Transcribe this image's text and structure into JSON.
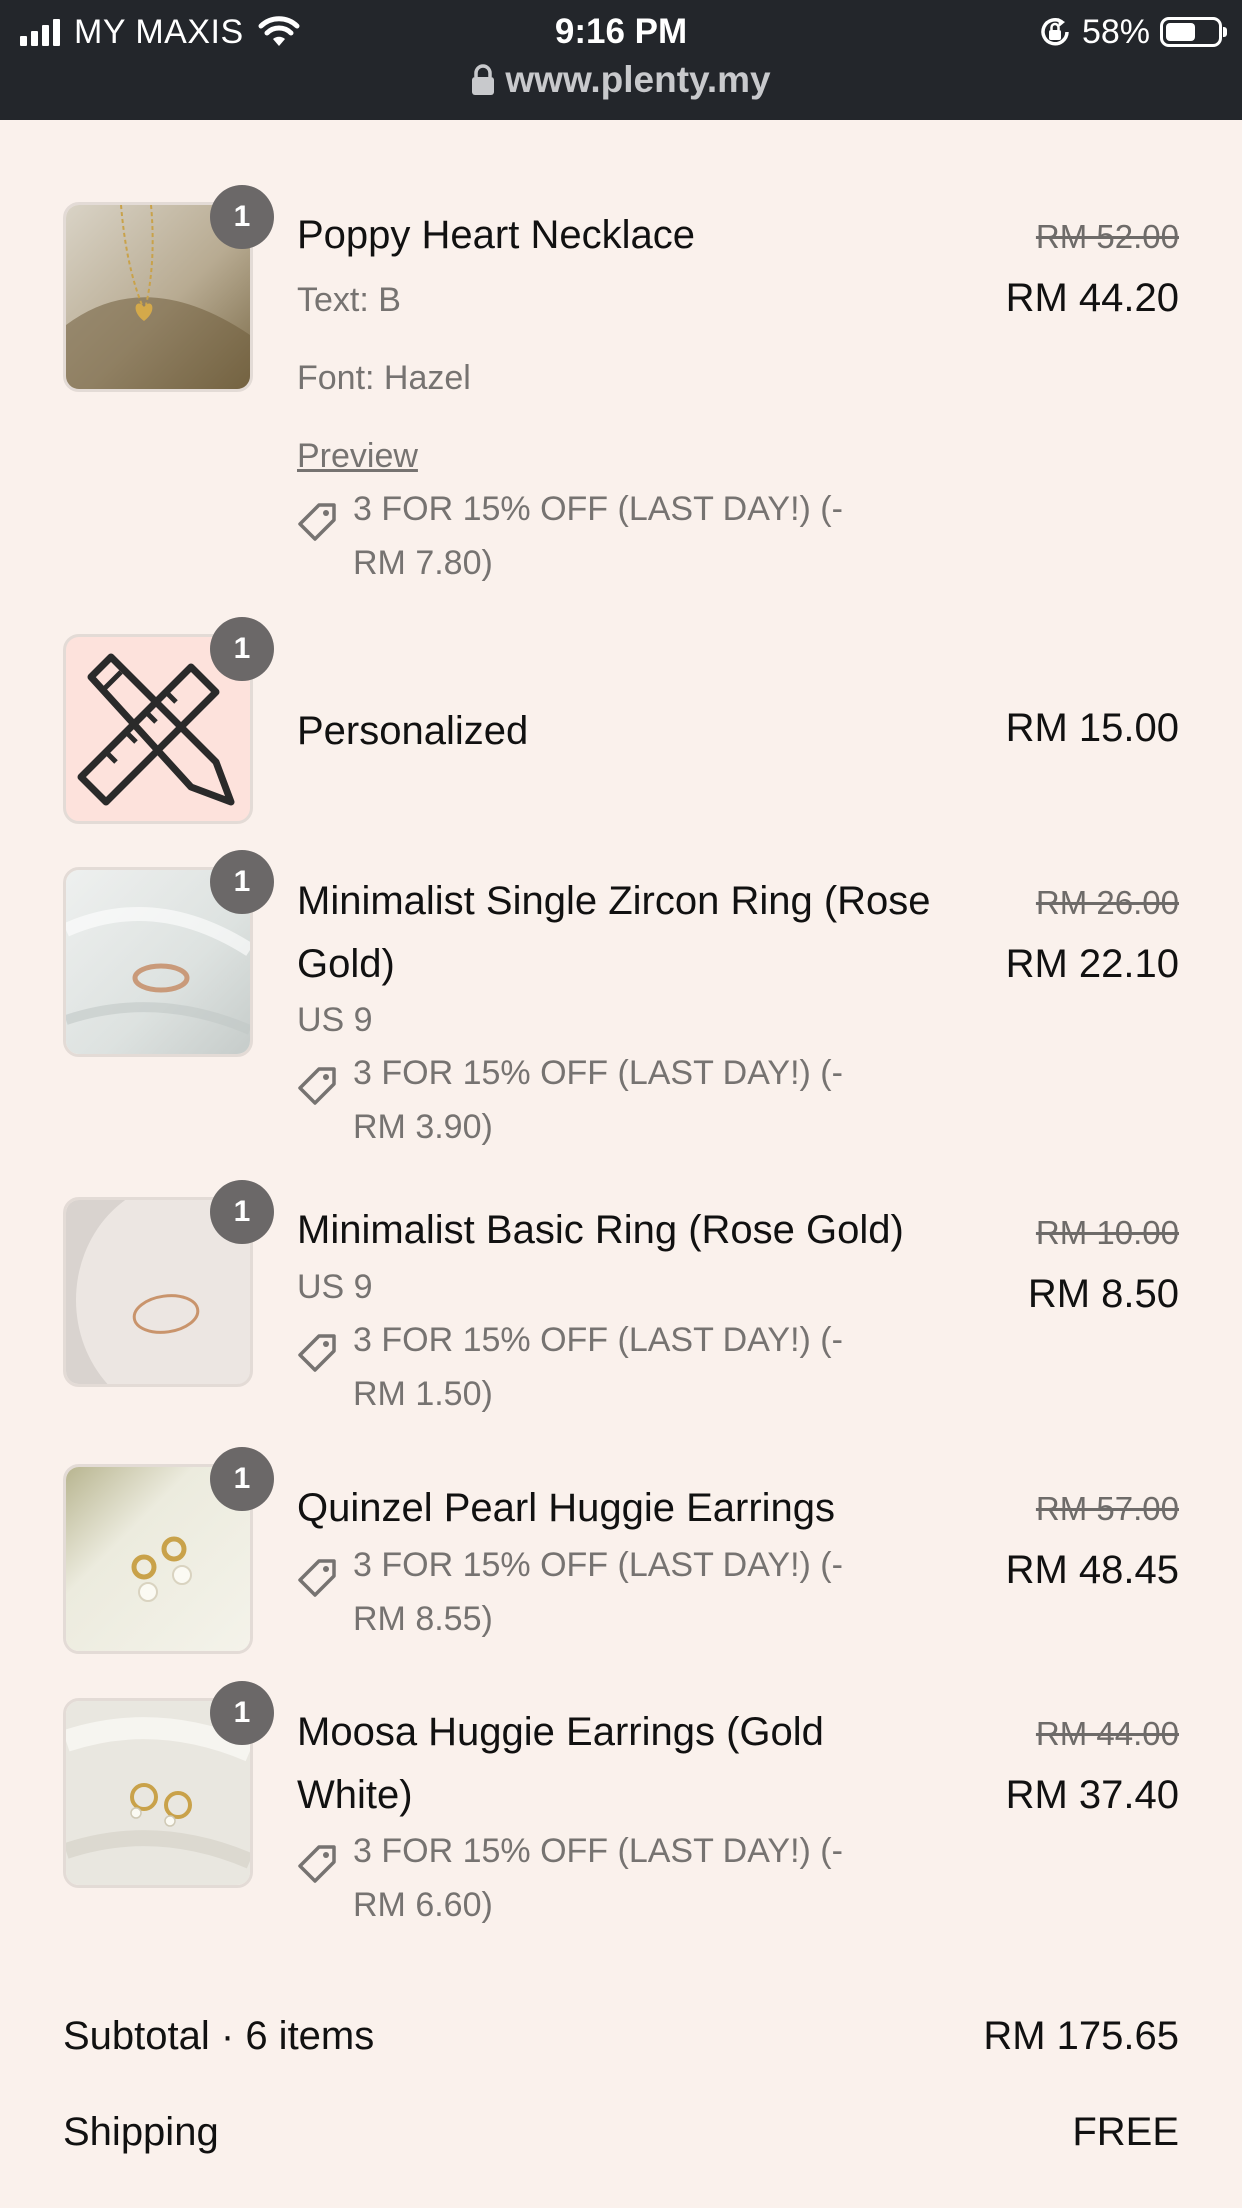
{
  "status_bar": {
    "carrier": "MY MAXIS",
    "time": "9:16 PM",
    "battery_percent": "58%",
    "battery_level": 0.58,
    "url": "www.plenty.my",
    "icons": [
      "signal-icon",
      "wifi-icon",
      "orientation-lock-icon",
      "battery-icon",
      "lock-icon"
    ]
  },
  "items": [
    {
      "quantity": "1",
      "name": "Poppy Heart Necklace",
      "variants": [
        "Text: B",
        "Font: Hazel"
      ],
      "preview_link": "Preview",
      "discount": "3 FOR 15% OFF (LAST DAY!) (-RM 7.80)",
      "old_price": "RM 52.00",
      "price": "RM 44.20"
    },
    {
      "quantity": "1",
      "name": "Personalized",
      "price": "RM 15.00"
    },
    {
      "quantity": "1",
      "name": "Minimalist Single Zircon Ring (Rose Gold)",
      "variant": "US 9",
      "discount": "3 FOR 15% OFF (LAST DAY!) (-RM 3.90)",
      "old_price": "RM 26.00",
      "price": "RM 22.10"
    },
    {
      "quantity": "1",
      "name": "Minimalist Basic Ring (Rose Gold)",
      "variant": "US 9",
      "discount": "3 FOR 15% OFF (LAST DAY!) (-RM 1.50)",
      "old_price": "RM 10.00",
      "price": "RM 8.50"
    },
    {
      "quantity": "1",
      "name": "Quinzel Pearl Huggie Earrings",
      "discount": "3 FOR 15% OFF (LAST DAY!) (-RM 8.55)",
      "old_price": "RM 57.00",
      "price": "RM 48.45"
    },
    {
      "quantity": "1",
      "name": "Moosa Huggie Earrings (Gold White)",
      "discount": "3 FOR 15% OFF (LAST DAY!) (-RM 6.60)",
      "old_price": "RM 44.00",
      "price": "RM 37.40"
    }
  ],
  "totals": {
    "subtotal_label": "Subtotal · 6 items",
    "subtotal_value": "RM 175.65",
    "shipping_label": "Shipping",
    "shipping_value": "FREE"
  },
  "colors": {
    "page_background": "#faf1ec",
    "status_bar": "#23262b",
    "badge": "#6b6868",
    "muted_text": "#767371"
  }
}
